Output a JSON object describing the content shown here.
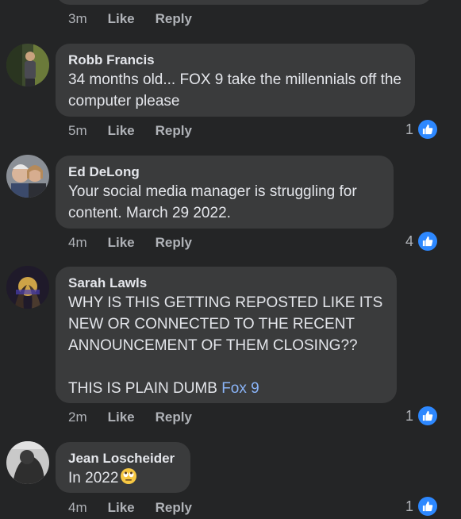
{
  "top": {
    "time": "3m",
    "like": "Like",
    "reply": "Reply"
  },
  "comments": [
    {
      "author": "Robb Francis",
      "text": "34 months old... FOX 9 take the millennials off the computer please",
      "time": "5m",
      "like": "Like",
      "reply": "Reply",
      "reactions": "1"
    },
    {
      "author": "Ed DeLong",
      "text": "Your social media manager is struggling for content. March 29 2022.",
      "time": "4m",
      "like": "Like",
      "reply": "Reply",
      "reactions": "4"
    },
    {
      "author": "Sarah Lawls",
      "text": "WHY IS THIS GETTING REPOSTED LIKE ITS NEW OR CONNECTED TO THE RECENT ANNOUNCEMENT OF THEM CLOSING??\n\nTHIS IS PLAIN DUMB ",
      "mention": "Fox 9",
      "time": "2m",
      "like": "Like",
      "reply": "Reply",
      "reactions": "1"
    },
    {
      "author": "Jean Loscheider",
      "text": "In 2022",
      "emoji": "eye-roll-emoji",
      "time": "4m",
      "like": "Like",
      "reply": "Reply",
      "reactions": "1"
    }
  ],
  "colors": {
    "background": "#242526",
    "bubble": "#3a3b3c",
    "like_blue": "#2d88ff",
    "mention": "#8ab4f8"
  }
}
